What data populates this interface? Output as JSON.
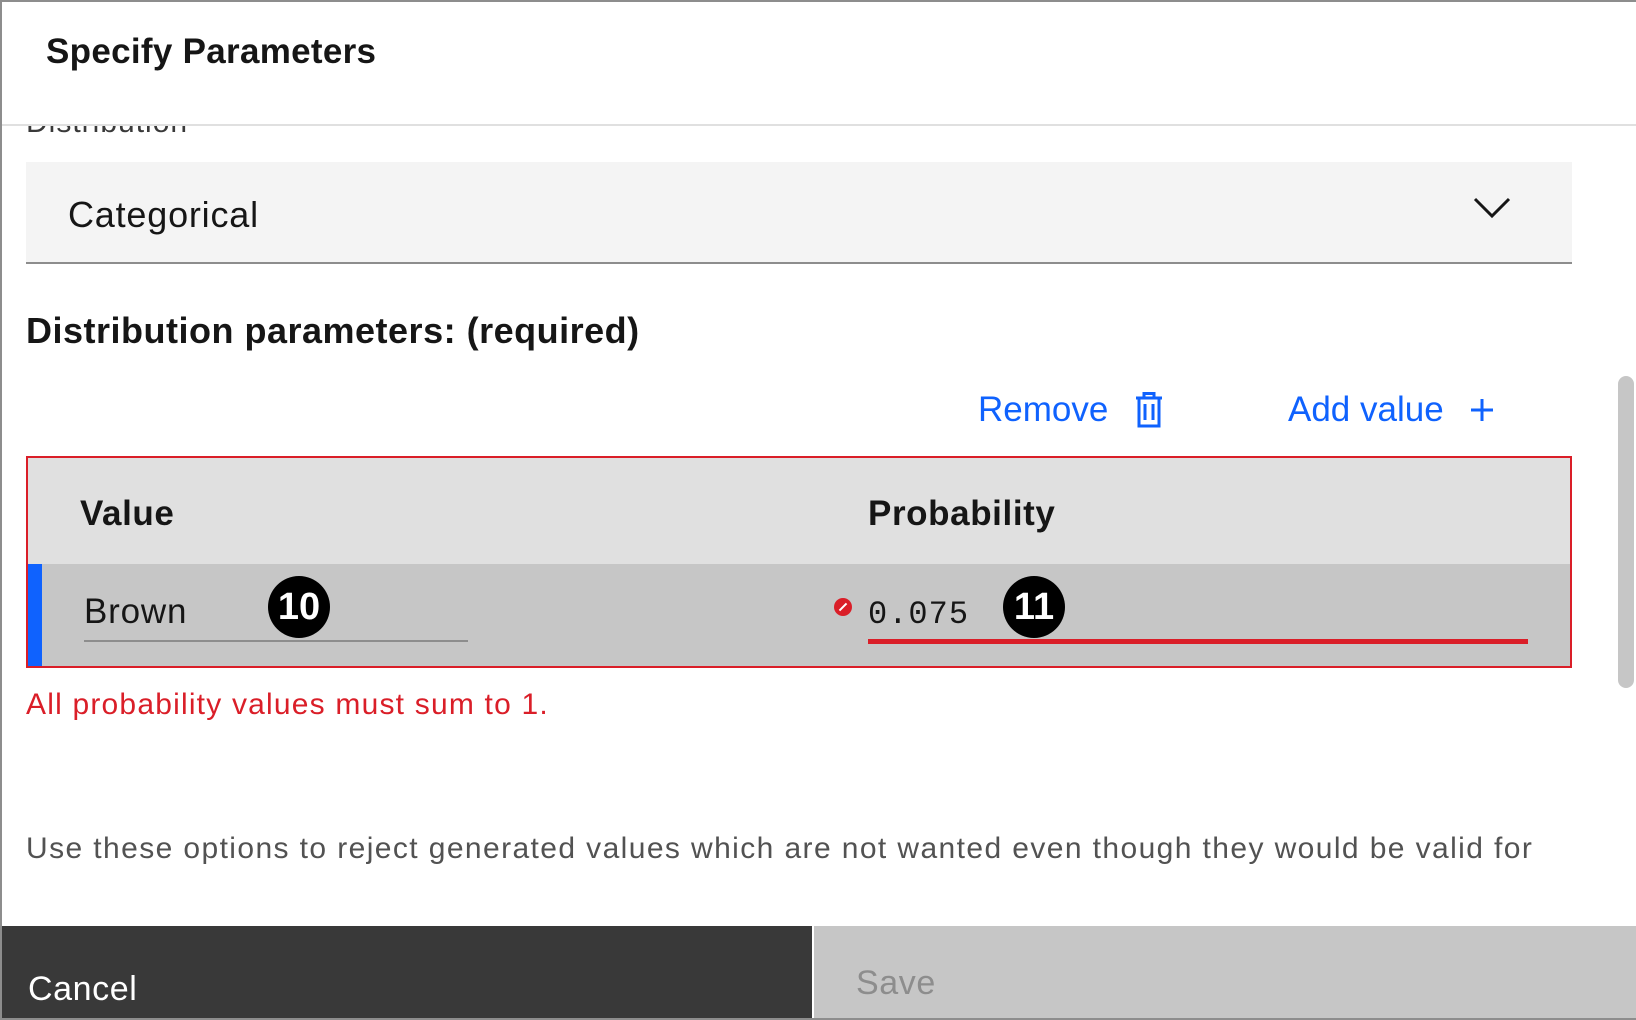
{
  "dialog": {
    "title": "Specify Parameters",
    "cut_label": "Distribution"
  },
  "distribution_select": {
    "value": "Categorical"
  },
  "parameters": {
    "title": "Distribution parameters: (required)",
    "remove_label": "Remove",
    "add_label": "Add value",
    "columns": [
      "Value",
      "Probability"
    ],
    "rows": [
      {
        "value": "Brown",
        "probability": "0.075"
      }
    ],
    "error": "All probability values must sum to 1."
  },
  "badges": [
    "10",
    "11"
  ],
  "helper_text": "Use these options to reject generated values which are not wanted even though they would be valid for",
  "footer": {
    "cancel_label": "Cancel",
    "save_label": "Save"
  },
  "colors": {
    "accent": "#0f62fe",
    "error": "#da1e28",
    "footer_dark": "#393939",
    "disabled": "#c6c6c6"
  },
  "icons": [
    "chevron-down-icon",
    "trash-icon",
    "plus-icon",
    "error-icon"
  ]
}
